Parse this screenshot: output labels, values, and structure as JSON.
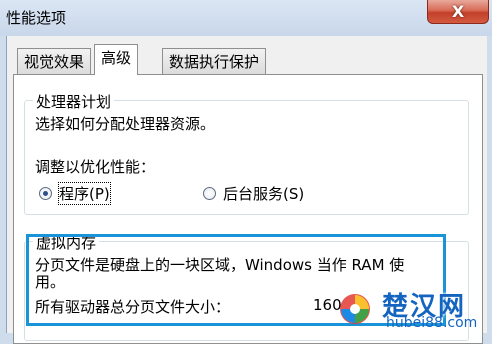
{
  "window": {
    "title": "性能选项",
    "close_glyph": "X"
  },
  "tabs": [
    {
      "label": "视觉效果",
      "active": false
    },
    {
      "label": "高级",
      "active": true
    },
    {
      "label": "数据执行保护",
      "active": false
    }
  ],
  "processor": {
    "legend": "处理器计划",
    "description": "选择如何分配处理器资源。",
    "adjust_label": "调整以优化性能：",
    "options": [
      {
        "label": "程序(P)",
        "checked": true
      },
      {
        "label": "后台服务(S)",
        "checked": false
      }
    ]
  },
  "virtual_memory": {
    "legend": "虚拟内存",
    "description_line1": "分页文件是硬盘上的一块区域，Windows 当作 RAM 使",
    "description_line2": "用。",
    "total_label": "所有驱动器总分页文件大小：",
    "total_value": "160"
  },
  "watermark": {
    "main": "楚汉网",
    "url": "hubei88.com"
  },
  "colors": {
    "highlight_border": "#1a94d8",
    "close_button": "#c2402a",
    "watermark": "#1565c0"
  }
}
